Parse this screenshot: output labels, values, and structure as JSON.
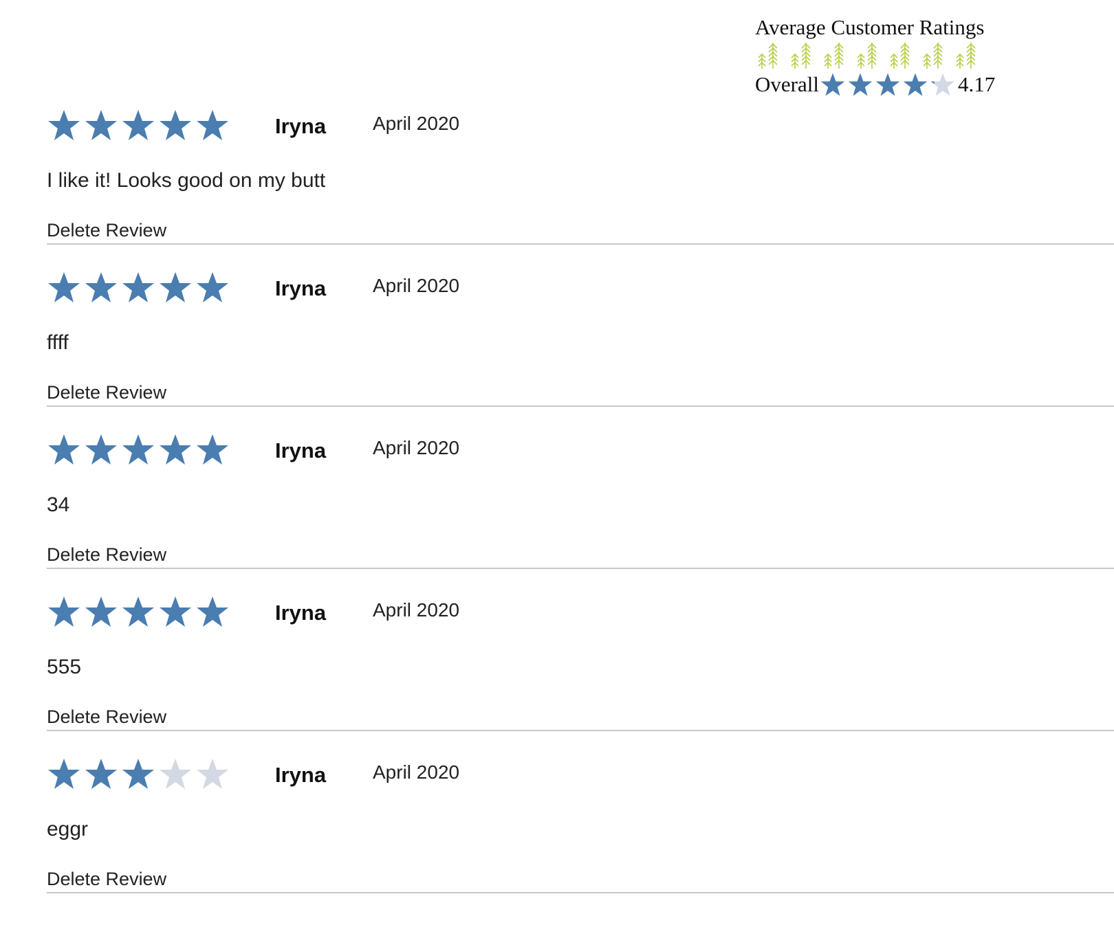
{
  "summary": {
    "title": "Average Customer Ratings",
    "overall_label": "Overall",
    "overall_value": "4.17",
    "overall_rating": 4.17,
    "tree_count": 7,
    "tree_color": "#b8d04a"
  },
  "colors": {
    "star_filled": "#4a7db0",
    "star_empty": "#d3d8e4"
  },
  "reviews": [
    {
      "rating": 5,
      "author": "Iryna",
      "date": "April 2020",
      "text": "I like it! Looks good on my butt",
      "delete_label": "Delete Review"
    },
    {
      "rating": 5,
      "author": "Iryna",
      "date": "April 2020",
      "text": "ffff",
      "delete_label": "Delete Review"
    },
    {
      "rating": 5,
      "author": "Iryna",
      "date": "April 2020",
      "text": "34",
      "delete_label": "Delete Review"
    },
    {
      "rating": 5,
      "author": "Iryna",
      "date": "April 2020",
      "text": "555",
      "delete_label": "Delete Review"
    },
    {
      "rating": 3,
      "author": "Iryna",
      "date": "April 2020",
      "text": "eggr",
      "delete_label": "Delete Review"
    }
  ]
}
